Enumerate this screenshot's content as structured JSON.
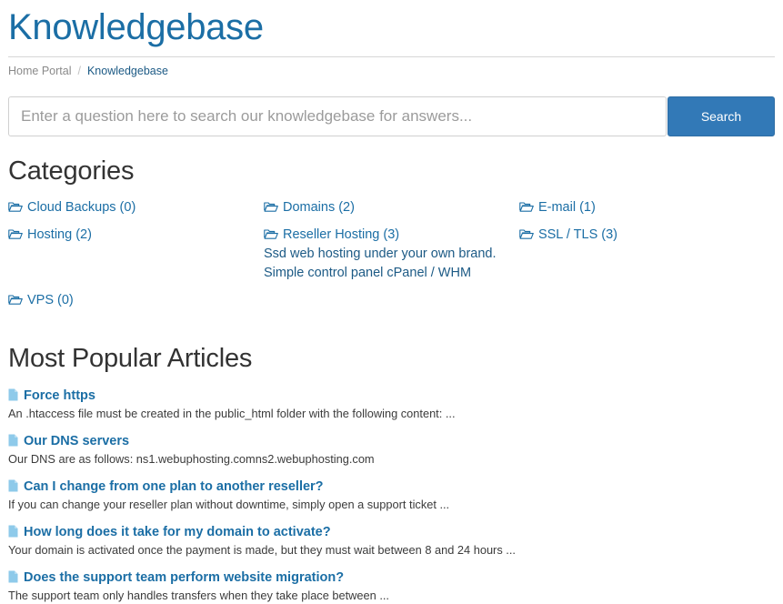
{
  "header": {
    "title": "Knowledgebase"
  },
  "breadcrumb": {
    "home_label": "Home Portal",
    "separator": "/",
    "current_label": "Knowledgebase"
  },
  "search": {
    "placeholder": "Enter a question here to search our knowledgebase for answers...",
    "value": "",
    "button_label": "Search"
  },
  "categories": {
    "heading": "Categories",
    "folder_icon": "folder-open-icon",
    "items": [
      {
        "label": "Cloud Backups (0)",
        "desc": ""
      },
      {
        "label": "Domains (2)",
        "desc": ""
      },
      {
        "label": "E-mail (1)",
        "desc": ""
      },
      {
        "label": "Hosting (2)",
        "desc": ""
      },
      {
        "label": "Reseller Hosting (3)",
        "desc": "Ssd web hosting under your own brand.",
        "desc2": "Simple control panel cPanel / WHM"
      },
      {
        "label": "SSL / TLS (3)",
        "desc": ""
      },
      {
        "label": "VPS (0)",
        "desc": ""
      }
    ]
  },
  "articles": {
    "heading": "Most Popular Articles",
    "doc_icon": "document-icon",
    "items": [
      {
        "title": "Force https",
        "desc": "An .htaccess file must be created in the public_html folder with the following content: ..."
      },
      {
        "title": "Our DNS servers",
        "desc": "Our DNS are as follows: ns1.webuphosting.comns2.webuphosting.com"
      },
      {
        "title": "Can I change from one plan to another reseller?",
        "desc": "If you can change your reseller plan without downtime, simply open a support ticket ..."
      },
      {
        "title": "How long does it take for my domain to activate?",
        "desc": "Your domain is activated once the payment is made, but they must wait between 8 and 24 hours ..."
      },
      {
        "title": "Does the support team perform website migration?",
        "desc": "The support team only handles transfers when they take place between ..."
      }
    ]
  },
  "colors": {
    "brand_blue": "#1b6ea5",
    "button_blue": "#3279b7",
    "heading_gray": "#333333",
    "muted_gray": "#8a8a8a",
    "doc_icon_blue": "#8ecaea"
  }
}
